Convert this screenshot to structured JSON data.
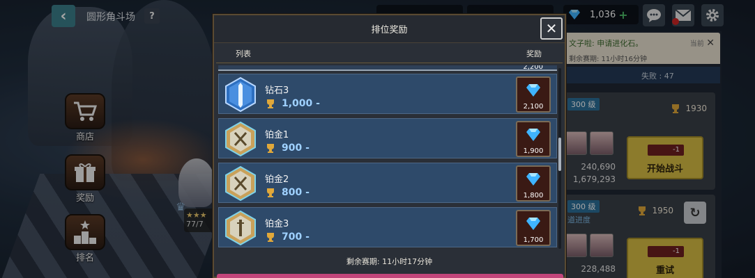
{
  "header": {
    "back_label": "‹",
    "title": "圆形角斗场",
    "help_label": "?",
    "gems": "1,036",
    "gems_plus": "+"
  },
  "nav": [
    {
      "label": "商店",
      "icon": "cart-icon"
    },
    {
      "label": "奖励",
      "icon": "gift-icon"
    },
    {
      "label": "排名",
      "icon": "podium-icon"
    }
  ],
  "hero": {
    "level_text": "77/7"
  },
  "notice": {
    "text": "文子啦: 申请进化石。",
    "now": "当前",
    "season": "剩余赛期: 11小时16分钟"
  },
  "stats": {
    "losses_label": "失败 :",
    "losses": "47"
  },
  "opponents": [
    {
      "level": "300 级",
      "trophy": "1930",
      "power1": "240,690",
      "power2": "1,679,293",
      "cost": "-1",
      "button": "开始战斗"
    },
    {
      "level": "300 级",
      "guild": "道进度",
      "trophy": "1950",
      "power1": "228,488",
      "cost": "-1",
      "button": "重试"
    }
  ],
  "modal": {
    "title": "排位奖励",
    "close_label": "✕",
    "col_list": "列表",
    "col_reward": "奖励",
    "peek_reward": "2,200",
    "rows": [
      {
        "name": "钻石3",
        "points": "1,000 -",
        "reward": "2,100",
        "tier": "diamond"
      },
      {
        "name": "铂金1",
        "points": "900 -",
        "reward": "1,900",
        "tier": "platinum"
      },
      {
        "name": "铂金2",
        "points": "800 -",
        "reward": "1,800",
        "tier": "platinum"
      },
      {
        "name": "铂金3",
        "points": "700 -",
        "reward": "1,700",
        "tier": "platinum"
      }
    ],
    "footer": "剩余赛期: 11小时17分钟"
  },
  "colors": {
    "accent_blue": "#9fd1ff",
    "gem": "#3fb4ff",
    "button_gold": "#d7bd44"
  }
}
